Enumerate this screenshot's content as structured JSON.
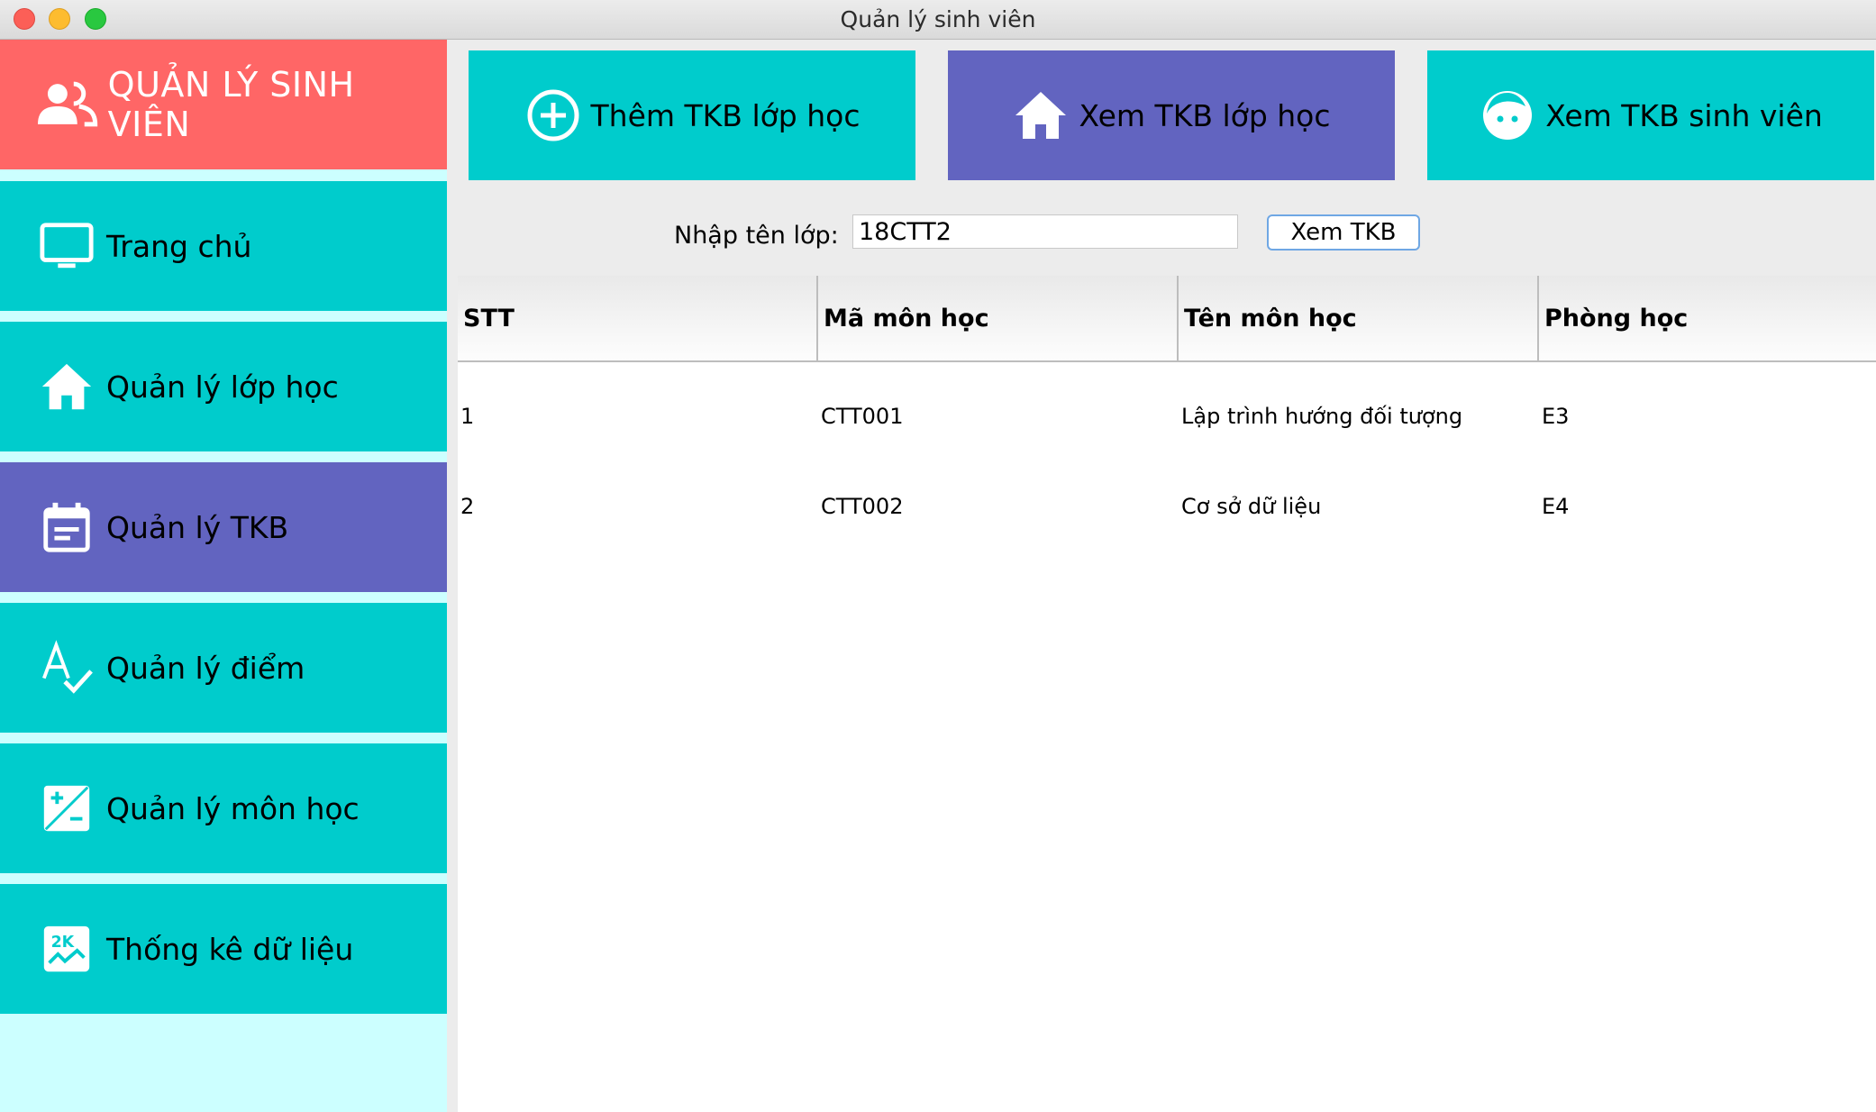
{
  "window": {
    "title": "Quản lý sinh viên"
  },
  "sidebar": {
    "brand": "QUẢN LÝ SINH VIÊN",
    "items": [
      {
        "label": "Trang chủ",
        "icon": "monitor-icon"
      },
      {
        "label": "Quản lý lớp học",
        "icon": "home-icon"
      },
      {
        "label": "Quản lý TKB",
        "icon": "calendar-icon",
        "active": true
      },
      {
        "label": "Quản lý điểm",
        "icon": "grade-icon"
      },
      {
        "label": "Quản lý môn học",
        "icon": "plus-minus-icon"
      },
      {
        "label": "Thống kê dữ liệu",
        "icon": "stats-icon"
      }
    ]
  },
  "toolbar": {
    "buttons": [
      {
        "label": "Thêm TKB lớp học",
        "icon": "add-circle-icon"
      },
      {
        "label": "Xem TKB lớp học",
        "icon": "home-icon",
        "active": true
      },
      {
        "label": "Xem TKB sinh viên",
        "icon": "face-icon"
      }
    ]
  },
  "search": {
    "label": "Nhập tên lớp:",
    "value": "18CTT2",
    "button": "Xem TKB"
  },
  "table": {
    "columns": [
      "STT",
      "Mã môn học",
      "Tên môn học",
      "Phòng học"
    ],
    "rows": [
      [
        "1",
        "CTT001",
        "Lập trình hướng đối tượng",
        "E3"
      ],
      [
        "2",
        "CTT002",
        "Cơ sở dữ liệu",
        "E4"
      ]
    ]
  },
  "colors": {
    "brand": "#ff6666",
    "teal": "#00cccc",
    "active": "#6264c0",
    "sidebar_bg": "#ccffff"
  }
}
